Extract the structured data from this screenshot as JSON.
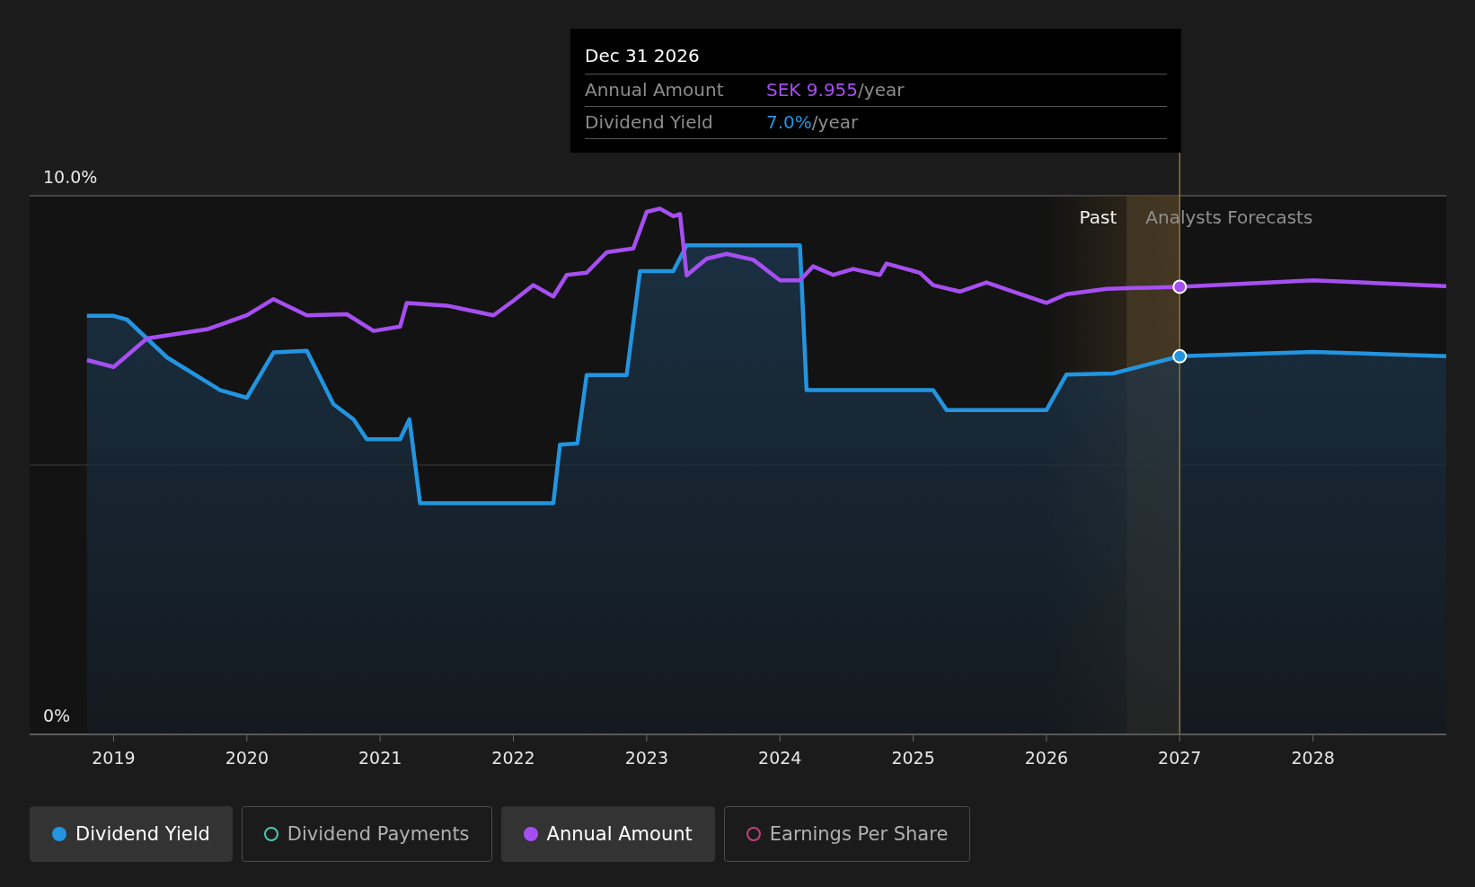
{
  "tooltip": {
    "date": "Dec 31 2026",
    "rows": [
      {
        "label": "Annual Amount",
        "value": "SEK 9.955",
        "unit": "/year",
        "color": "#a64ff0"
      },
      {
        "label": "Dividend Yield",
        "value": "7.0%",
        "unit": "/year",
        "color": "#2394df"
      }
    ]
  },
  "chart": {
    "past_label": "Past",
    "forecast_label": "Analysts Forecasts",
    "chart_data": {
      "type": "line",
      "xlim": [
        2018.37,
        2029
      ],
      "ylim": [
        0,
        10
      ],
      "bands": [
        {
          "axis": "x",
          "from": 2026,
          "to": 2027
        }
      ],
      "ref_lines": [
        {
          "axis": "y",
          "value": 5
        },
        {
          "axis": "x",
          "value": 2027
        }
      ],
      "xticks": [
        2019,
        2020,
        2021,
        2022,
        2023,
        2024,
        2025,
        2026,
        2027,
        2028
      ],
      "yticks": [
        {
          "value": 10,
          "label": "10.0%"
        },
        {
          "value": 0,
          "label": "0%"
        }
      ],
      "series": [
        {
          "type": "area",
          "color": "#2394df",
          "x": [
            2018.8,
            2019.0,
            2019.1,
            2019.4,
            2019.8,
            2020.0,
            2020.2,
            2020.45,
            2020.65,
            2020.8,
            2020.9,
            2021.15,
            2021.22,
            2021.3,
            2022.3,
            2022.35,
            2022.48,
            2022.55,
            2022.85,
            2022.95,
            2023.2,
            2023.3,
            2024.15,
            2024.2,
            2025.15,
            2025.25,
            2026.0,
            2026.15,
            2026.5,
            2027.0,
            2028.0,
            2029.0
          ],
          "values": [
            7.77,
            7.77,
            7.7,
            7.0,
            6.39,
            6.25,
            7.09,
            7.12,
            6.13,
            5.85,
            5.48,
            5.48,
            5.85,
            4.29,
            4.29,
            5.38,
            5.4,
            6.67,
            6.67,
            8.6,
            8.6,
            9.08,
            9.08,
            6.39,
            6.39,
            6.02,
            6.02,
            6.68,
            6.7,
            7.02,
            7.1,
            7.02
          ]
        },
        {
          "type": "line",
          "color": "#a64ff0",
          "x": [
            2018.8,
            2019.0,
            2019.25,
            2019.7,
            2020.0,
            2020.2,
            2020.45,
            2020.75,
            2020.95,
            2021.15,
            2021.2,
            2021.5,
            2021.85,
            2022.0,
            2022.15,
            2022.3,
            2022.4,
            2022.55,
            2022.7,
            2022.9,
            2023.0,
            2023.1,
            2023.2,
            2023.25,
            2023.3,
            2023.45,
            2023.6,
            2023.8,
            2024.0,
            2024.15,
            2024.25,
            2024.4,
            2024.55,
            2024.75,
            2024.8,
            2025.05,
            2025.15,
            2025.35,
            2025.55,
            2025.75,
            2026.0,
            2026.15,
            2026.45,
            2027.0,
            2028.0,
            2029.0
          ],
          "values": [
            6.95,
            6.82,
            7.35,
            7.52,
            7.78,
            8.08,
            7.78,
            7.8,
            7.49,
            7.57,
            8.01,
            7.96,
            7.78,
            8.05,
            8.34,
            8.13,
            8.53,
            8.57,
            8.95,
            9.02,
            9.7,
            9.76,
            9.62,
            9.66,
            8.52,
            8.83,
            8.92,
            8.81,
            8.43,
            8.43,
            8.69,
            8.53,
            8.64,
            8.53,
            8.74,
            8.57,
            8.34,
            8.22,
            8.39,
            8.22,
            8.01,
            8.17,
            8.27,
            8.31,
            8.43,
            8.32
          ]
        }
      ]
    }
  },
  "legend": [
    {
      "label": "Dividend Yield",
      "color": "#2394df",
      "selected": true
    },
    {
      "label": "Dividend Payments",
      "color": "#4cc9b0",
      "selected": false
    },
    {
      "label": "Annual Amount",
      "color": "#a64ff0",
      "selected": true
    },
    {
      "label": "Earnings Per Share",
      "color": "#c0407a",
      "selected": false
    }
  ]
}
